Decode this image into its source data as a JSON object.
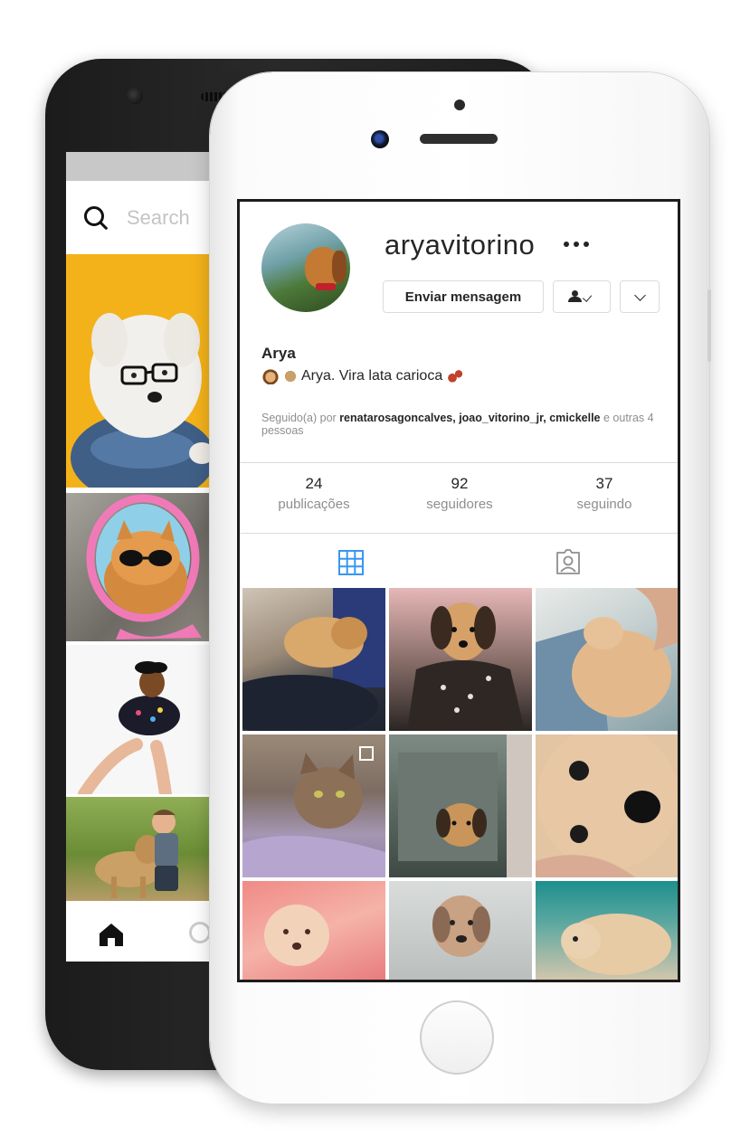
{
  "back_phone": {
    "search_placeholder": "Search"
  },
  "profile": {
    "username": "aryavitorino",
    "name": "Arya",
    "bio_text": "Arya. Vira lata carioca",
    "followed_by_prefix": "Seguido(a) por",
    "followed_by_users": "renatarosagoncalves, joao_vitorino_jr, cmickelle",
    "followed_by_suffix": "e outras 4 pessoas",
    "buttons": {
      "message_label": "Enviar mensagem"
    },
    "stats": [
      {
        "value": "24",
        "label": "publicações"
      },
      {
        "value": "92",
        "label": "seguidores"
      },
      {
        "value": "37",
        "label": "seguindo"
      }
    ]
  },
  "colors": {
    "accent_blue": "#3897f0",
    "text_primary": "#262626",
    "text_secondary": "#8e8e8e",
    "border": "#dbdbdb"
  },
  "icons": {
    "more": "more-icon",
    "following": "person-check-icon",
    "dropdown": "chevron-down-icon",
    "grid_tab": "grid-icon",
    "tagged_tab": "tagged-person-icon",
    "home": "home-icon",
    "search": "search-icon"
  }
}
